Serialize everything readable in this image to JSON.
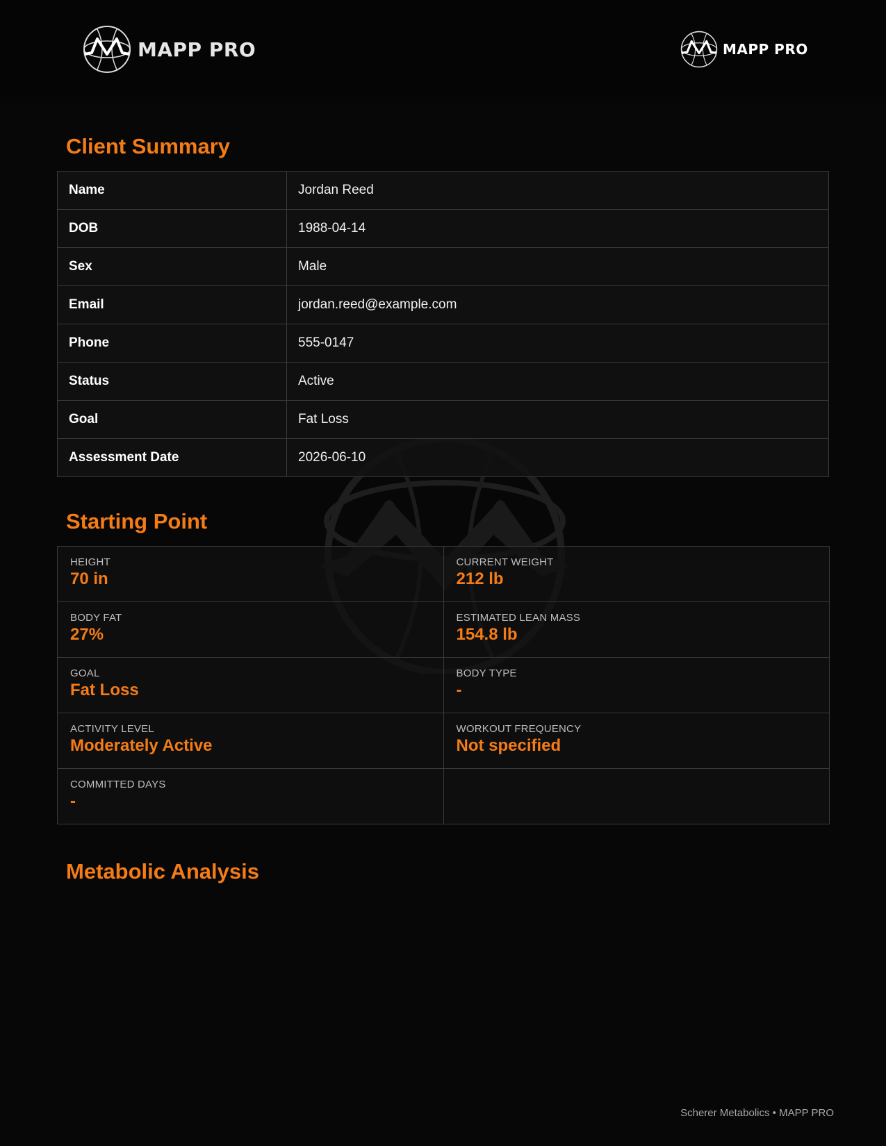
{
  "brand": {
    "name": "MAPP PRO"
  },
  "sections": {
    "client_summary": "Client Summary",
    "starting_point": "Starting Point",
    "metabolic_analysis": "Metabolic Analysis"
  },
  "client_summary": [
    {
      "label": "Name",
      "value": "Jordan Reed"
    },
    {
      "label": "DOB",
      "value": "1988-04-14"
    },
    {
      "label": "Sex",
      "value": "Male"
    },
    {
      "label": "Email",
      "value": "jordan.reed@example.com"
    },
    {
      "label": "Phone",
      "value": "555-0147"
    },
    {
      "label": "Status",
      "value": "Active"
    },
    {
      "label": "Goal",
      "value": "Fat Loss"
    },
    {
      "label": "Assessment Date",
      "value": "2026-06-10"
    }
  ],
  "starting_point": [
    {
      "label": "HEIGHT",
      "value": "70 in"
    },
    {
      "label": "CURRENT WEIGHT",
      "value": "212 lb"
    },
    {
      "label": "BODY FAT",
      "value": "27%"
    },
    {
      "label": "ESTIMATED LEAN MASS",
      "value": "154.8 lb"
    },
    {
      "label": "GOAL",
      "value": "Fat Loss"
    },
    {
      "label": "BODY TYPE",
      "value": "-"
    },
    {
      "label": "ACTIVITY LEVEL",
      "value": "Moderately Active"
    },
    {
      "label": "WORKOUT FREQUENCY",
      "value": "Not specified"
    },
    {
      "label": "COMMITTED DAYS",
      "value": "-"
    }
  ],
  "footer": {
    "text": "Scherer Metabolics • MAPP PRO"
  },
  "colors": {
    "accent": "#f47c17",
    "background": "#070707",
    "border": "#3a3a3a"
  }
}
